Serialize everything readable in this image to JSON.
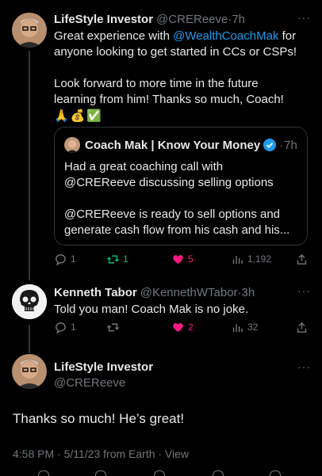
{
  "tweet1": {
    "name": "LifeStyle Investor",
    "handle": "@CREReeve",
    "time": "7h",
    "line1_pre": "Great experience with ",
    "line1_link": "@WealthCoachMak",
    "line1_post": " for",
    "line2": "anyone looking to get started in CCs or CSPs!",
    "line3": "Look forward to more time in the future",
    "line4": "learning from him!  Thanks so much, Coach!",
    "emojis": "🙏💰✅",
    "replies": "1",
    "retweets": "1",
    "likes": "5",
    "views": "1,192"
  },
  "quote": {
    "name": "Coach Mak | Know Your Money",
    "time": "7h",
    "line1": "Had a great coaching call with",
    "line2": "@CREReeve discussing selling options",
    "line3": "@CREReeve is ready to sell options and",
    "line4": "generate cash flow from his cash and his..."
  },
  "tweet2": {
    "name": "Kenneth Tabor",
    "handle": "@KennethWTabor",
    "time": "3h",
    "text": "Told you man! Coach Mak is no joke.",
    "replies": "1",
    "likes": "2",
    "views": "32"
  },
  "main": {
    "name": "LifeStyle Investor",
    "handle": "@CREReeve",
    "text": "Thanks so much!  He’s great!",
    "meta": "4:58 PM · 5/11/23 from Earth · View"
  },
  "colors": {
    "accent": "#1d9bf0",
    "retweet": "#00ba7c",
    "like": "#f91880",
    "muted": "#71767b"
  },
  "icons": [
    "reply-icon",
    "retweet-icon",
    "heart-icon",
    "views-icon",
    "share-icon",
    "more-icon",
    "verified-icon"
  ]
}
